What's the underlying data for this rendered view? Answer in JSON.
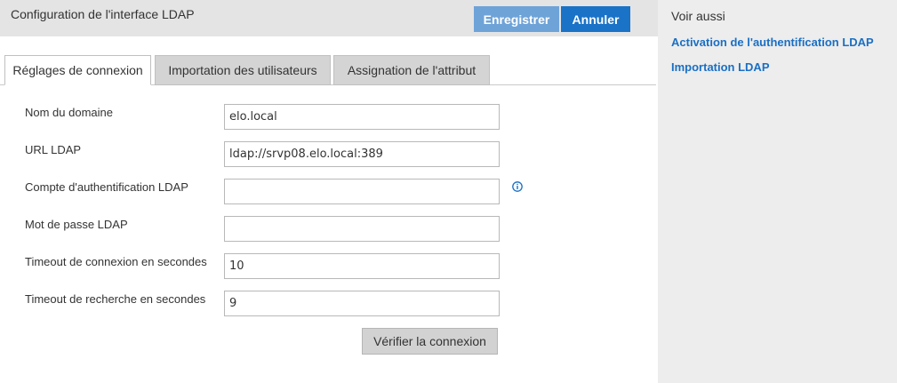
{
  "header": {
    "title": "Configuration de l'interface LDAP",
    "save_label": "Enregistrer",
    "cancel_label": "Annuler"
  },
  "tabs": [
    {
      "label": "Réglages de connexion",
      "active": true
    },
    {
      "label": "Importation des utilisateurs",
      "active": false
    },
    {
      "label": "Assignation de l'attribut",
      "active": false
    }
  ],
  "form": {
    "fields": [
      {
        "label": "Nom du domaine",
        "value": "elo.local"
      },
      {
        "label": "URL LDAP",
        "value": "ldap://srvp08.elo.local:389"
      },
      {
        "label": "Compte d'authentification LDAP",
        "value": ""
      },
      {
        "label": "Mot de passe LDAP",
        "value": ""
      },
      {
        "label": "Timeout de connexion en secondes",
        "value": "10"
      },
      {
        "label": "Timeout de recherche en secondes",
        "value": "9"
      }
    ],
    "verify_label": "Vérifier la connexion",
    "info_icon": "info-circle-icon"
  },
  "sidebar": {
    "title": "Voir aussi",
    "links": [
      {
        "label": "Activation de l'authentification LDAP"
      },
      {
        "label": "Importation LDAP"
      }
    ]
  },
  "colors": {
    "primary": "#1a73c7",
    "primary_light": "#6ea3d8",
    "link": "#1a6fc4",
    "header_bg": "#e4e4e4",
    "sidebar_bg": "#ededed"
  }
}
